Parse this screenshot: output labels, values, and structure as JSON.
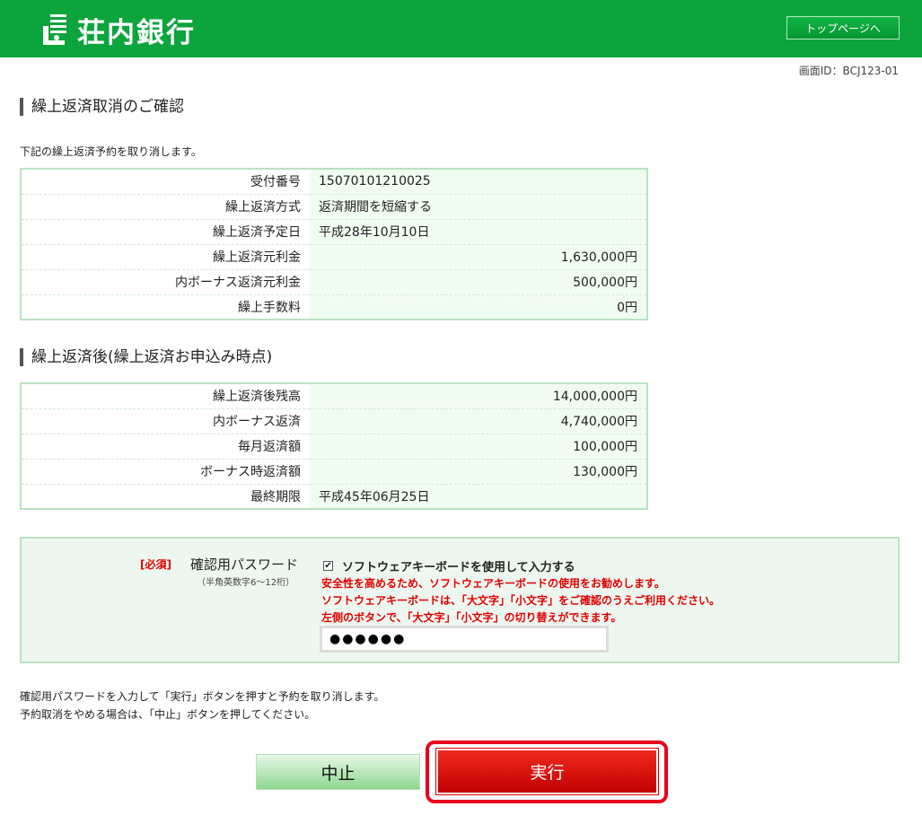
{
  "header": {
    "bank_name": "荘内銀行",
    "top_page_label": "トップページへ"
  },
  "screen_id": "画面ID：BCJ123-01",
  "section1": {
    "title": "繰上返済取消のご確認",
    "intro": "下記の繰上返済予約を取り消します。",
    "rows": [
      {
        "label": "受付番号",
        "value": "15070101210025"
      },
      {
        "label": "繰上返済方式",
        "value": "返済期間を短縮する"
      },
      {
        "label": "繰上返済予定日",
        "value": "平成28年10月10日"
      },
      {
        "label": "繰上返済元利金",
        "value": "1,630,000円"
      },
      {
        "label": "内ボーナス返済元利金",
        "value": "500,000円"
      },
      {
        "label": "繰上手数料",
        "value": "0円"
      }
    ]
  },
  "section2": {
    "title": "繰上返済後(繰上返済お申込み時点)",
    "rows": [
      {
        "label": "繰上返済後残高",
        "value": "14,000,000円"
      },
      {
        "label": "内ボーナス返済",
        "value": "4,740,000円"
      },
      {
        "label": "毎月返済額",
        "value": "100,000円"
      },
      {
        "label": "ボーナス時返済額",
        "value": "130,000円"
      },
      {
        "label": "最終期限",
        "value": "平成45年06月25日"
      }
    ]
  },
  "password": {
    "required_label": "[必須]",
    "label": "確認用パスワード",
    "sublabel": "（半角英数字6～12桁）",
    "software_keyboard_label": "ソフトウェアキーボードを使用して入力する",
    "software_keyboard_checked": true,
    "warning1": "安全性を高めるため、ソフトウェアキーボードの使用をお勧めします。",
    "warning2": "ソフトウェアキーボードは、「大文字」「小文字」をご確認のうえご利用ください。",
    "warning3": "左側のボタンで、「大文字」「小文字」の切り替えができます。",
    "value": "●●●●●●"
  },
  "notes": {
    "line1": "確認用パスワードを入力して「実行」ボタンを押すと予約を取り消します。",
    "line2": "予約取消をやめる場合は、「中止」ボタンを押してください。"
  },
  "buttons": {
    "cancel": "中止",
    "execute": "実行"
  }
}
